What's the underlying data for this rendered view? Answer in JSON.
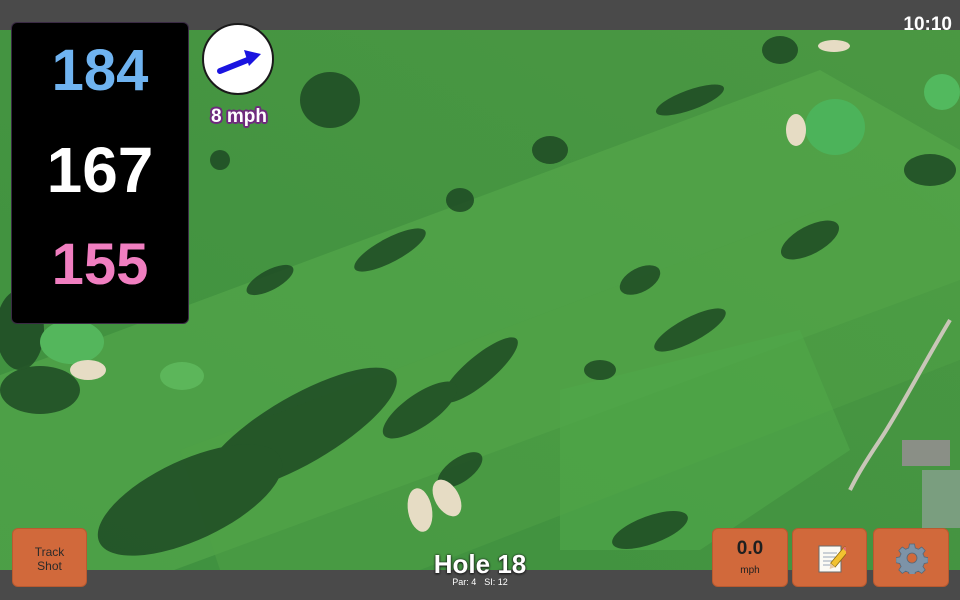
{
  "status_bar": {
    "time": "10:10"
  },
  "distances": {
    "back": "184",
    "middle": "167",
    "front": "155",
    "back_color": "#6fb3f0",
    "middle_color": "#ffffff",
    "front_color": "#f07ec0"
  },
  "wind": {
    "speed": "8 mph",
    "arrow_color": "#1a14e0",
    "icon": "wind-direction-arrow-icon"
  },
  "buttons": {
    "track_shot_line1": "Track",
    "track_shot_line2": "Shot",
    "speed_value": "0.0",
    "speed_unit": "mph",
    "scorecard_icon": "notepad-icon",
    "settings_icon": "gear-icon",
    "accent": "#d1693b"
  },
  "hole": {
    "title": "Hole 18",
    "par": "Par: 4",
    "stroke_index": "SI: 12"
  }
}
